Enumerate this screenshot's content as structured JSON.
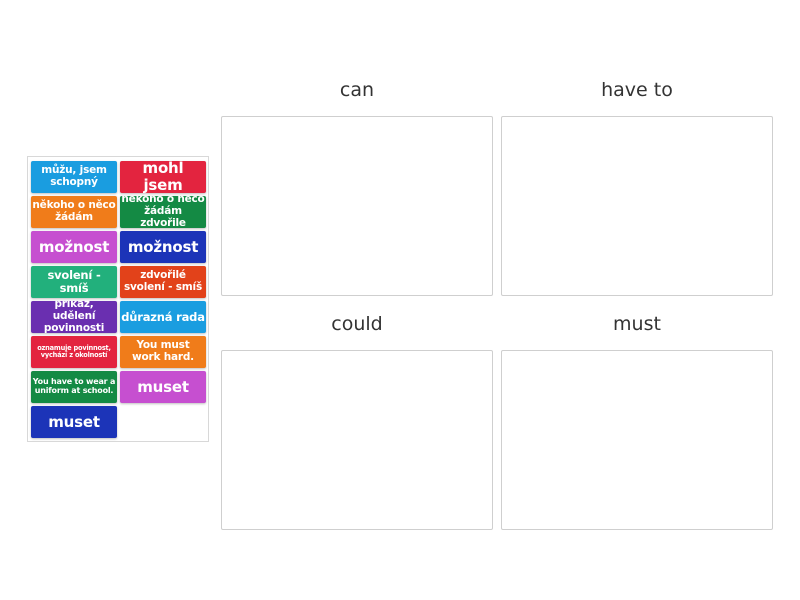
{
  "zones": [
    {
      "title": "can"
    },
    {
      "title": "have to"
    },
    {
      "title": "could"
    },
    {
      "title": "must"
    }
  ],
  "cards": [
    {
      "text": "můžu, jsem schopný",
      "color": "#1a9de0"
    },
    {
      "text": "mohl jsem",
      "color": "#e3243f"
    },
    {
      "text": "někoho o něco žádám",
      "color": "#f07c1a"
    },
    {
      "text": "někoho o něco žádám zdvořile",
      "color": "#148a44"
    },
    {
      "text": "možnost",
      "color": "#c64fd0"
    },
    {
      "text": "možnost",
      "color": "#1c34b8"
    },
    {
      "text": "svolení - smíš",
      "color": "#22b07c"
    },
    {
      "text": "zdvořilé svolení - smíš",
      "color": "#e2421a"
    },
    {
      "text": "příkaz, udělení povinnosti",
      "color": "#6a2fb0"
    },
    {
      "text": "důrazná rada",
      "color": "#1a9de0"
    },
    {
      "text": "oznamuje povinnost, vychází z okolností",
      "color": "#e3243f"
    },
    {
      "text": "You must work hard.",
      "color": "#f07c1a"
    },
    {
      "text": "You have to wear a uniform at school.",
      "color": "#148a44"
    },
    {
      "text": "muset",
      "color": "#c64fd0"
    },
    {
      "text": "muset",
      "color": "#1c34b8"
    }
  ]
}
